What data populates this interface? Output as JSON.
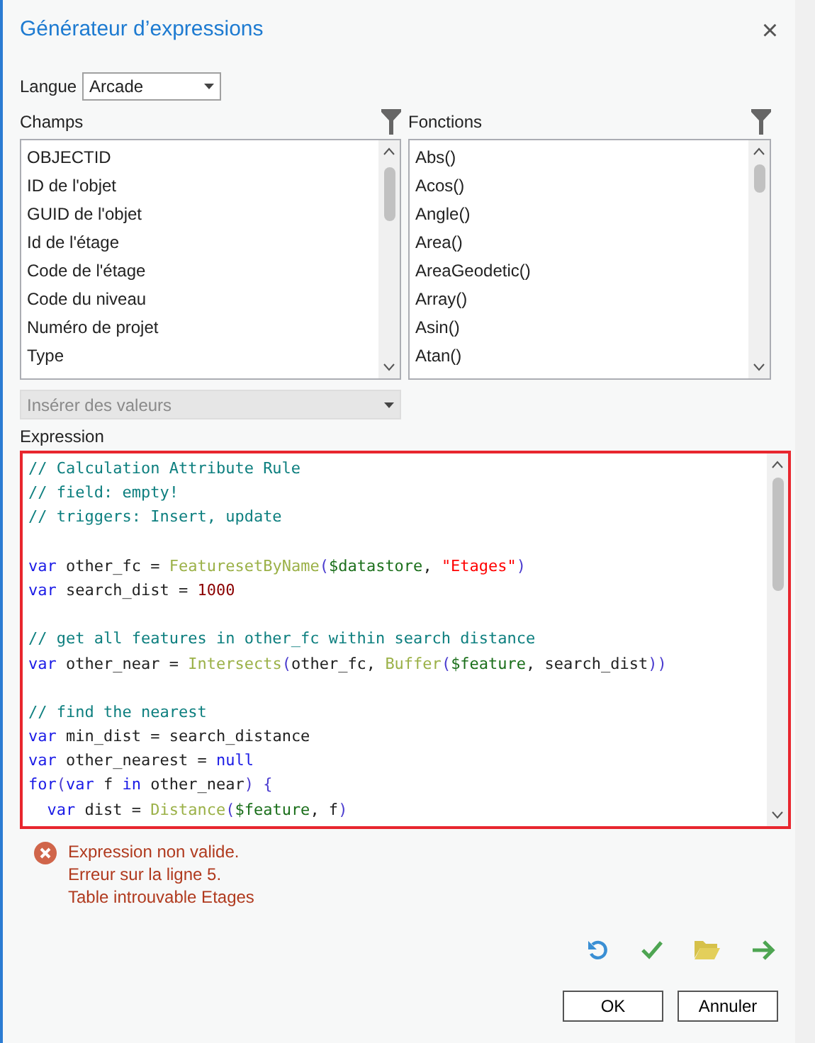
{
  "window": {
    "title": "Générateur d’expressions",
    "close": "×"
  },
  "language": {
    "label": "Langue",
    "value": "Arcade"
  },
  "fields": {
    "label": "Champs",
    "items": [
      {
        "text": "OBJECTID",
        "selected": false
      },
      {
        "text": "ID de l'objet",
        "selected": false
      },
      {
        "text": "GUID de l'objet",
        "selected": false
      },
      {
        "text": "Id de l'étage",
        "selected": false
      },
      {
        "text": "Code de l'étage",
        "selected": false
      },
      {
        "text": "Code du niveau",
        "selected": false
      },
      {
        "text": "Numéro de projet",
        "selected": false
      },
      {
        "text": "Type",
        "selected": false
      }
    ]
  },
  "functions": {
    "label": "Fonctions",
    "items": [
      {
        "text": "Abs()",
        "selected": false
      },
      {
        "text": "Acos()",
        "selected": false
      },
      {
        "text": "Angle()",
        "selected": false
      },
      {
        "text": "Area()",
        "selected": false
      },
      {
        "text": "AreaGeodetic()",
        "selected": false
      },
      {
        "text": "Array()",
        "selected": false
      },
      {
        "text": "Asin()",
        "selected": false
      },
      {
        "text": "Atan()",
        "selected": false
      }
    ]
  },
  "insert_values": {
    "placeholder": "Insérer des valeurs",
    "disabled": true
  },
  "expression": {
    "label": "Expression",
    "invalid": true,
    "lines": [
      {
        "tokens": [
          {
            "kind": "comment",
            "text": "// Calculation Attribute Rule"
          }
        ]
      },
      {
        "tokens": [
          {
            "kind": "comment",
            "text": "// field: empty!"
          }
        ]
      },
      {
        "tokens": [
          {
            "kind": "comment",
            "text": "// triggers: Insert, update"
          }
        ]
      },
      {
        "kind": "blank"
      },
      {
        "tokens": [
          {
            "kind": "keyword",
            "text": "var"
          },
          {
            "kind": "plain",
            "text": " other_fc = "
          },
          {
            "kind": "function",
            "text": "FeaturesetByName"
          },
          {
            "kind": "paren",
            "text": "("
          },
          {
            "kind": "global",
            "text": "$datastore"
          },
          {
            "kind": "plain",
            "text": ", "
          },
          {
            "kind": "string",
            "text": "\"Etages\""
          },
          {
            "kind": "paren",
            "text": ")"
          }
        ]
      },
      {
        "tokens": [
          {
            "kind": "keyword",
            "text": "var"
          },
          {
            "kind": "plain",
            "text": " search_dist = "
          },
          {
            "kind": "number",
            "text": "1000"
          }
        ]
      },
      {
        "kind": "blank"
      },
      {
        "tokens": [
          {
            "kind": "comment",
            "text": "// get all features in other_fc within search distance"
          }
        ]
      },
      {
        "tokens": [
          {
            "kind": "keyword",
            "text": "var"
          },
          {
            "kind": "plain",
            "text": " other_near = "
          },
          {
            "kind": "function",
            "text": "Intersects"
          },
          {
            "kind": "paren",
            "text": "("
          },
          {
            "kind": "plain",
            "text": "other_fc, "
          },
          {
            "kind": "function",
            "text": "Buffer"
          },
          {
            "kind": "paren",
            "text": "("
          },
          {
            "kind": "global",
            "text": "$feature"
          },
          {
            "kind": "plain",
            "text": ", search_dist"
          },
          {
            "kind": "paren",
            "text": "))"
          }
        ]
      },
      {
        "kind": "blank"
      },
      {
        "tokens": [
          {
            "kind": "comment",
            "text": "// find the nearest"
          }
        ]
      },
      {
        "tokens": [
          {
            "kind": "keyword",
            "text": "var"
          },
          {
            "kind": "plain",
            "text": " min_dist = search_distance"
          }
        ]
      },
      {
        "tokens": [
          {
            "kind": "keyword",
            "text": "var"
          },
          {
            "kind": "plain",
            "text": " other_nearest = "
          },
          {
            "kind": "keyword",
            "text": "null"
          }
        ]
      },
      {
        "tokens": [
          {
            "kind": "keyword",
            "text": "for"
          },
          {
            "kind": "paren",
            "text": "("
          },
          {
            "kind": "keyword",
            "text": "var"
          },
          {
            "kind": "plain",
            "text": " f "
          },
          {
            "kind": "keyword",
            "text": "in"
          },
          {
            "kind": "plain",
            "text": " other_near"
          },
          {
            "kind": "paren",
            "text": ") {"
          }
        ]
      },
      {
        "indented": true,
        "tokens": [
          {
            "kind": "keyword",
            "text": "var"
          },
          {
            "kind": "plain",
            "text": " dist = "
          },
          {
            "kind": "function",
            "text": "Distance"
          },
          {
            "kind": "paren",
            "text": "("
          },
          {
            "kind": "global",
            "text": "$feature"
          },
          {
            "kind": "plain",
            "text": ", f"
          },
          {
            "kind": "paren",
            "text": ")"
          }
        ]
      }
    ]
  },
  "errors": [
    "Expression non valide.",
    "Erreur sur la ligne 5.",
    "Table introuvable Etages"
  ],
  "buttons": [
    {
      "text": "OK"
    },
    {
      "text": "Annuler"
    }
  ]
}
